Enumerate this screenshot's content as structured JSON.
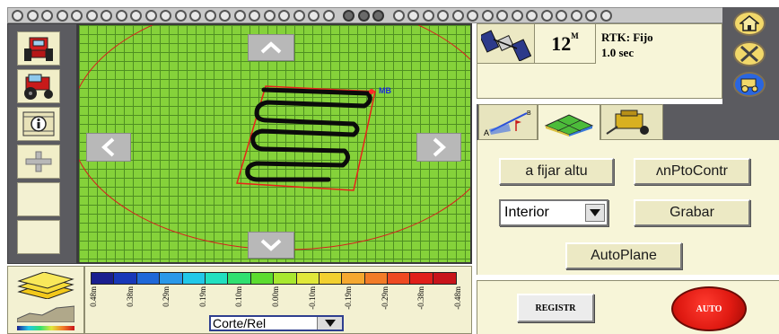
{
  "top_indicator": {
    "led_count": 40,
    "dark_leds": [
      22,
      23,
      24
    ]
  },
  "left_toolbar": {
    "items": [
      {
        "name": "tractor-front-view",
        "icon": "tractor-icon"
      },
      {
        "name": "tractor-side-view",
        "icon": "tractor-side-icon"
      },
      {
        "name": "info",
        "icon": "info-icon"
      },
      {
        "name": "zoom-in",
        "icon": "plus-icon"
      },
      {
        "name": "blank-1"
      },
      {
        "name": "blank-2"
      }
    ]
  },
  "map": {
    "marker_label": "MB",
    "nav": {
      "up": "up-arrow-icon",
      "down": "down-arrow-icon",
      "left": "left-arrow-icon",
      "right": "right-arrow-icon"
    },
    "colors": {
      "field": "#85d23a",
      "grid": "#4f8f22",
      "boundary": "#e8231a",
      "path": "#0b0b0b"
    }
  },
  "gps_status": {
    "satellite_count": "12",
    "satellite_suffix": "M",
    "rtk_line1": "RTK: Fijo",
    "rtk_line2": "1.0 sec"
  },
  "side_buttons": [
    {
      "name": "home",
      "icon": "home-icon"
    },
    {
      "name": "tools",
      "icon": "tools-icon"
    },
    {
      "name": "vehicle",
      "icon": "vehicle-icon"
    }
  ],
  "tabs": [
    {
      "name": "survey-tab",
      "icon": "survey-line-icon"
    },
    {
      "name": "surface-tab",
      "icon": "grid-surface-icon",
      "active": true
    },
    {
      "name": "implement-tab",
      "icon": "scraper-icon"
    }
  ],
  "controls": {
    "fijar_label": "a fijar altu",
    "punto_control_label": "ʌnPtoContr",
    "interior_value": "Interior",
    "grabar_label": "Grabar",
    "autoplane_label": "AutoPlane"
  },
  "bottom": {
    "registr_label": "REGISTR",
    "auto_label": "AUTO",
    "view_select": "Corte/Rel"
  },
  "legend": {
    "colors": [
      "#1a1f8f",
      "#1838b8",
      "#1f68d8",
      "#2a98e8",
      "#22c8e8",
      "#22e0c0",
      "#30e070",
      "#5cdc30",
      "#a8e830",
      "#e0e83a",
      "#f2d030",
      "#f5a830",
      "#f27c28",
      "#ee4a22",
      "#e01f1a",
      "#c8141a"
    ],
    "labels": [
      "0.48m",
      "0.38m",
      "0.29m",
      "0.19m",
      "0.10m",
      "0.00m",
      "-0.10m",
      "-0.19m",
      "-0.29m",
      "-0.38m",
      "-0.48m"
    ]
  }
}
